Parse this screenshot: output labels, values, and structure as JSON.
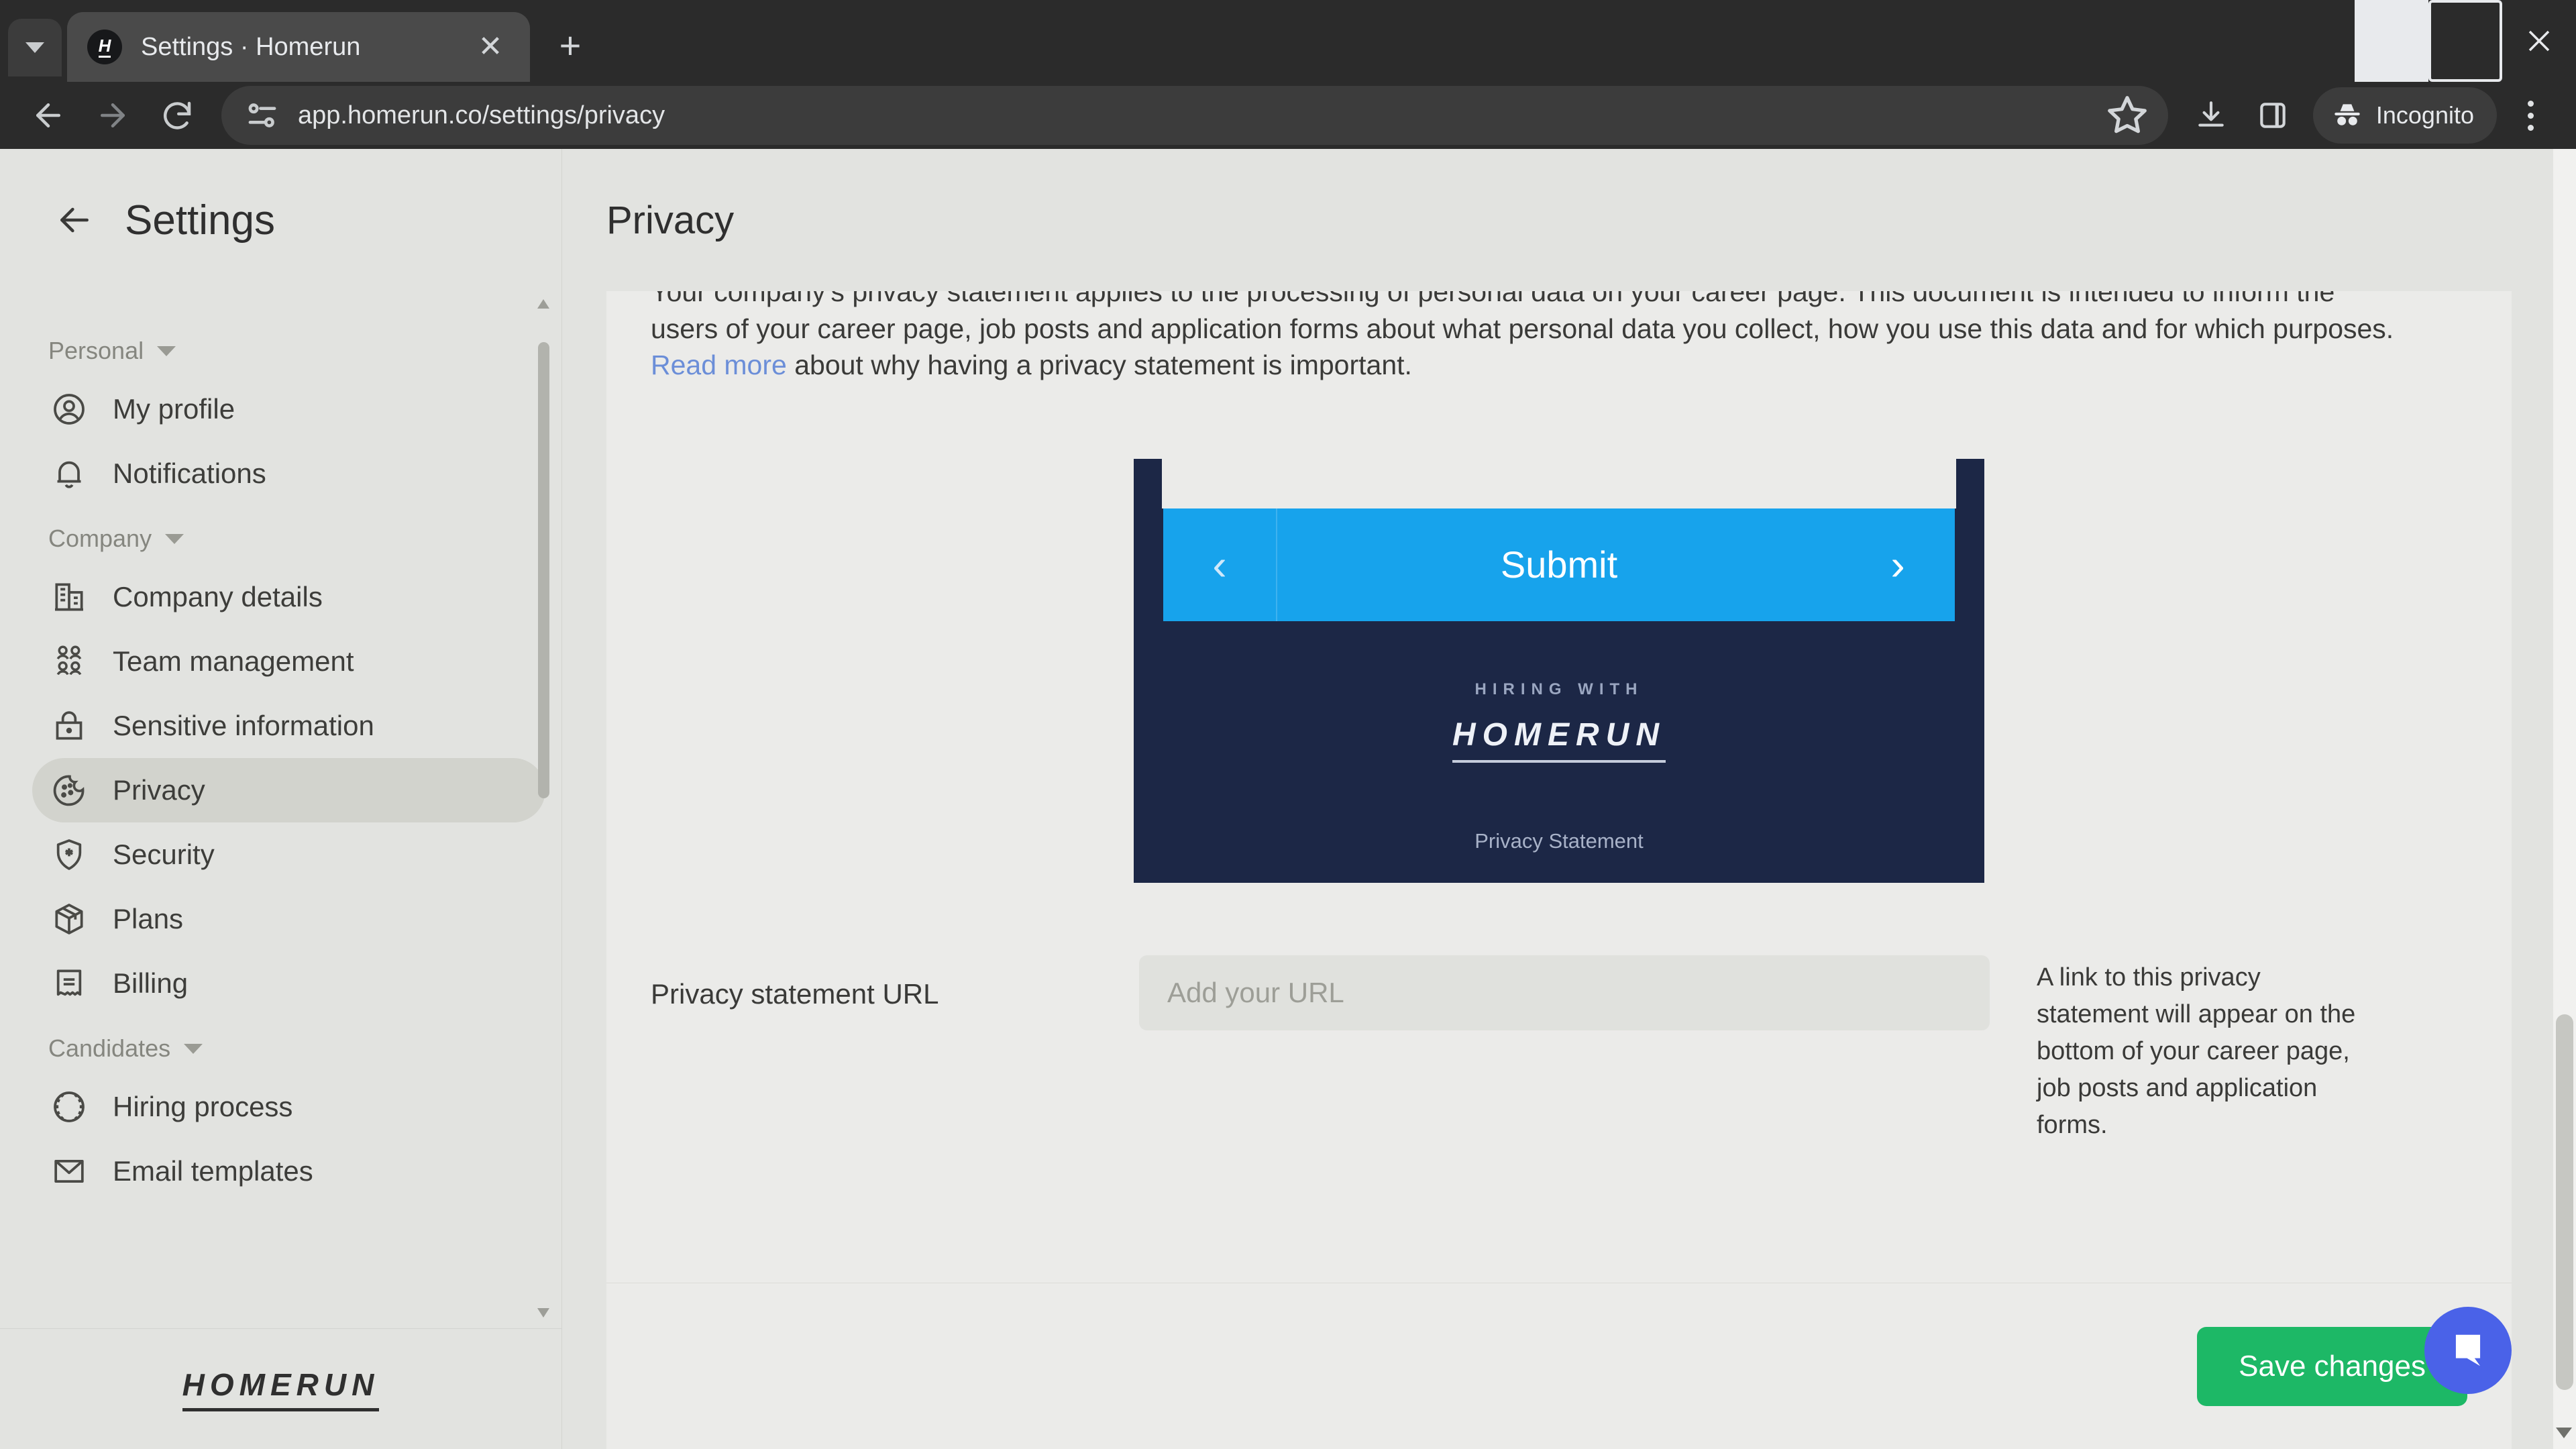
{
  "browser": {
    "tab": {
      "title": "Settings · Homerun",
      "favicon_letter": "H",
      "close_icon": "close-icon"
    },
    "new_tab_label": "+",
    "url": "app.homerun.co/settings/privacy",
    "incognito_label": "Incognito",
    "icons": {
      "tab_list": "chevron-down-icon",
      "back": "back-arrow-icon",
      "forward": "forward-arrow-icon",
      "reload": "reload-icon",
      "site_settings": "site-settings-icon",
      "bookmark": "star-icon",
      "downloads": "download-icon",
      "side_panel": "side-panel-icon",
      "incognito": "incognito-icon",
      "menu": "kebab-menu-icon",
      "minimize": "minimize-icon",
      "maximize": "maximize-icon",
      "close_window": "window-close-icon"
    }
  },
  "sidebar": {
    "title": "Settings",
    "back_icon": "back-arrow-icon",
    "logo": "HOMERUN",
    "groups": [
      {
        "label": "Personal",
        "items": [
          {
            "label": "My profile",
            "icon": "user-circle-icon",
            "active": false
          },
          {
            "label": "Notifications",
            "icon": "bell-icon",
            "active": false
          }
        ]
      },
      {
        "label": "Company",
        "items": [
          {
            "label": "Company details",
            "icon": "building-icon",
            "active": false
          },
          {
            "label": "Team management",
            "icon": "people-icon",
            "active": false
          },
          {
            "label": "Sensitive information",
            "icon": "lock-icon",
            "active": false
          },
          {
            "label": "Privacy",
            "icon": "cookie-icon",
            "active": true
          },
          {
            "label": "Security",
            "icon": "shield-icon",
            "active": false
          },
          {
            "label": "Plans",
            "icon": "box-icon",
            "active": false
          },
          {
            "label": "Billing",
            "icon": "receipt-icon",
            "active": false
          }
        ]
      },
      {
        "label": "Candidates",
        "items": [
          {
            "label": "Hiring process",
            "icon": "baseball-icon",
            "active": false
          },
          {
            "label": "Email templates",
            "icon": "envelope-icon",
            "active": false
          }
        ]
      }
    ]
  },
  "main": {
    "title": "Privacy",
    "intro": {
      "clipped_line": "Your company's privacy statement applies to the processing of personal data on your career page. This document is",
      "part1": "intended to inform the users of your career page, job posts and application forms about what personal data you collect, how you use this data and for which purposes. ",
      "link": "Read more",
      "part2": " about why having a privacy statement is important."
    },
    "preview": {
      "submit_label": "Submit",
      "prev_icon": "chevron-left-icon",
      "next_icon": "chevron-right-icon",
      "hiring_with": "HIRING WITH",
      "brand": "HOMERUN",
      "privacy_statement": "Privacy Statement"
    },
    "url_field": {
      "label": "Privacy statement URL",
      "value": "",
      "placeholder": "Add your URL",
      "help": "A link to this privacy statement will appear on the bottom of your career page, job posts and application forms."
    },
    "save_label": "Save changes"
  },
  "widgets": {
    "chat_icon": "chat-bubble-icon"
  },
  "colors": {
    "accent_blue": "#17a3ec",
    "preview_navy": "#1c2746",
    "save_green": "#1db866",
    "chat_purple": "#4a62e8",
    "link_blue": "#6b8ed8"
  }
}
